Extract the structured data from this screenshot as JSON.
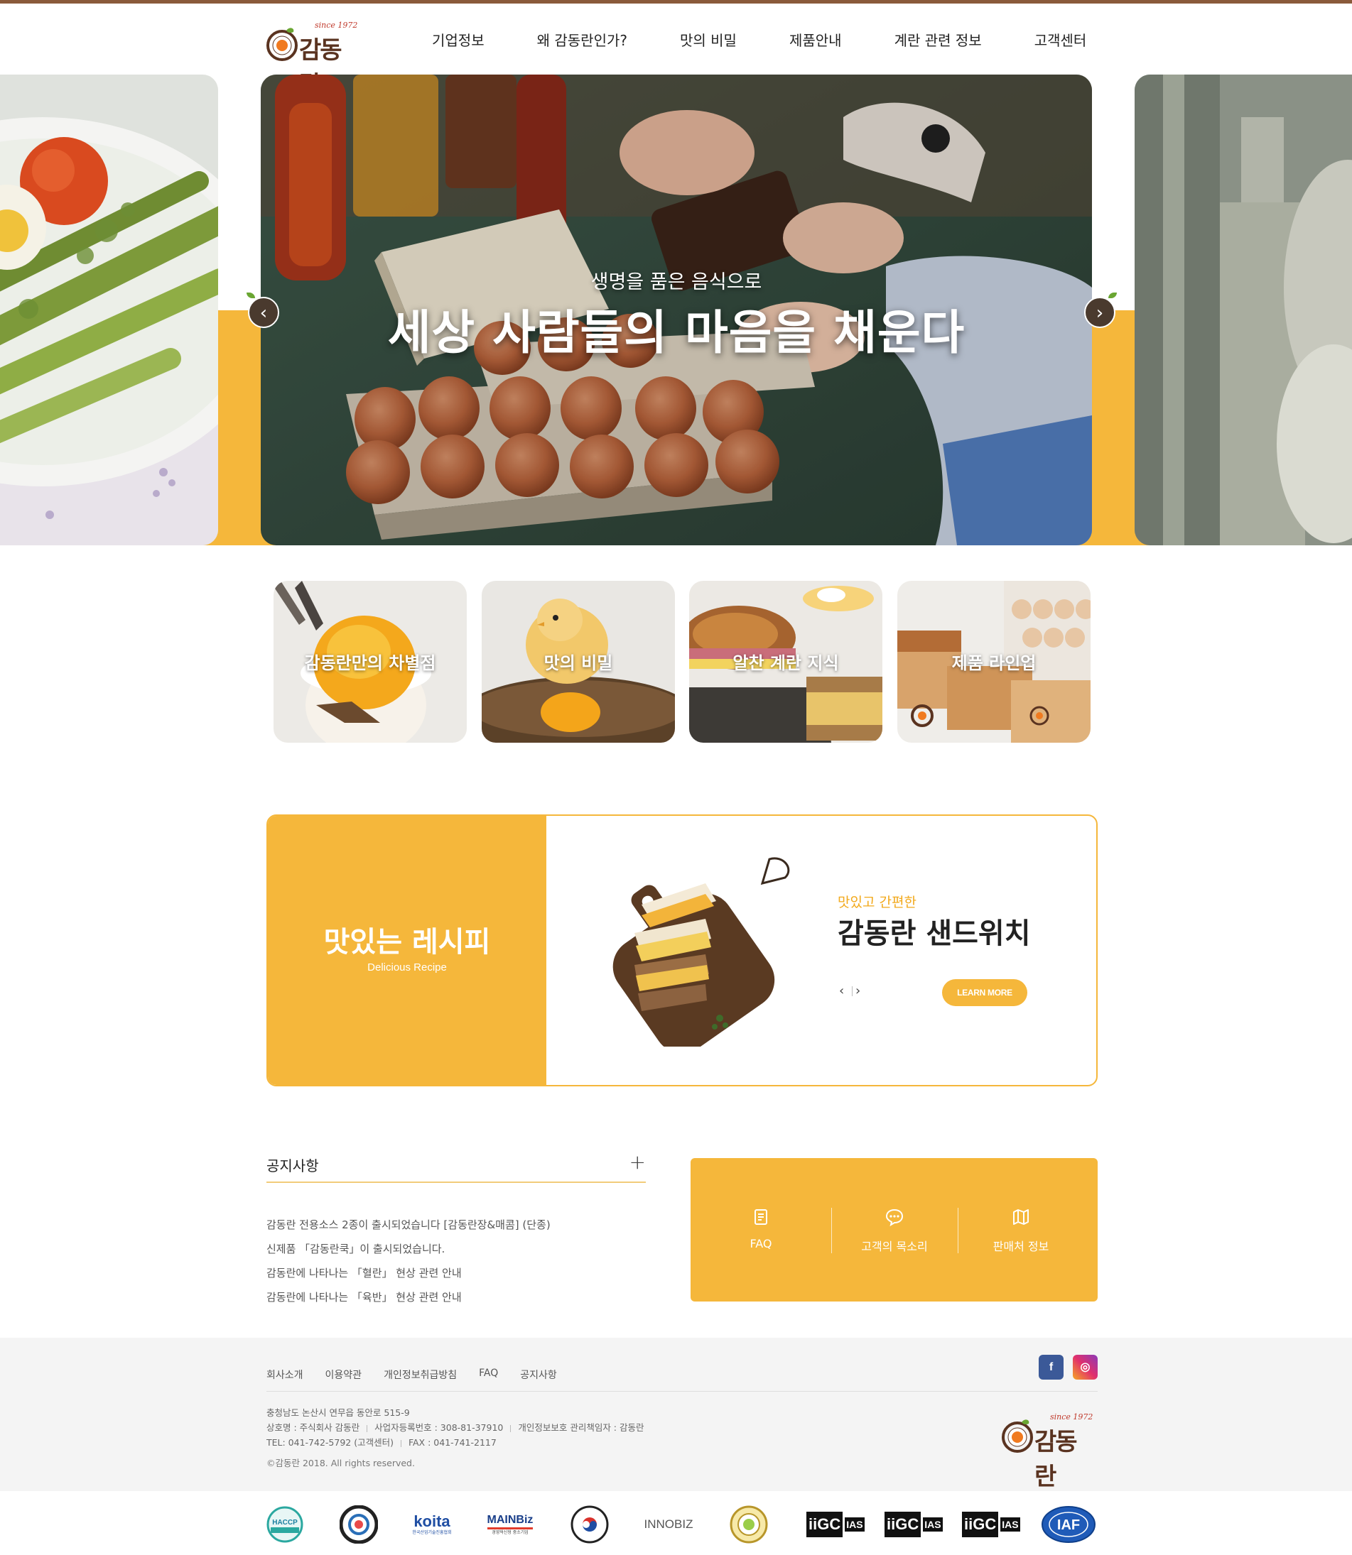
{
  "brand": {
    "since": "since 1972",
    "name": "감동란"
  },
  "nav": {
    "items": [
      "기업정보",
      "왜 감동란인가?",
      "맛의 비밀",
      "제품안내",
      "계란 관련 정보",
      "고객센터"
    ]
  },
  "hero": {
    "subtitle": "생명을 품은 음식으로",
    "title": "세상 사람들의 마음을 채운다",
    "prev_label": "‹",
    "next_label": "›"
  },
  "tiles": [
    "감동란만의 차별점",
    "맛의 비밀",
    "알찬 계란 지식",
    "제품 라인업"
  ],
  "recipe": {
    "title": "맛있는 레시피",
    "subtitle": "Delicious Recipe",
    "kicker": "맛있고 간편한",
    "name": "감동란 샌드위치",
    "prev": "‹",
    "next": "›",
    "button": "LEARN MORE"
  },
  "notice": {
    "title": "공지사항",
    "more": "+",
    "items": [
      "감동란 전용소스 2종이 출시되었습니다 [감동란장&매콤] (단종)",
      "신제품 「감동란쿡」이 출시되었습니다.",
      "감동란에 나타나는 「혈란」 현상 관련 안내",
      "감동란에 나타나는 「육반」 현상 관련 안내"
    ]
  },
  "quick": {
    "items": [
      {
        "label": "FAQ",
        "icon": "document-icon"
      },
      {
        "label": "고객의 목소리",
        "icon": "chat-bubble-icon"
      },
      {
        "label": "판매처 정보",
        "icon": "map-icon"
      }
    ]
  },
  "footer": {
    "links": [
      "회사소개",
      "이용약관",
      "개인정보취급방침",
      "FAQ",
      "공지사항"
    ],
    "address": "충청남도 논산시 연무읍 동안로 515-9",
    "company": "상호명 : 주식회사 감동란",
    "biz_no": "사업자등록번호 : 308-81-37910",
    "privacy": "개인정보보호 관리책임자 : 감동란",
    "tel": "TEL: 041-742-5792 (고객센터)",
    "fax": "FAX : 041-741-2117",
    "copyright": "©감동란 2018. All rights reserved.",
    "sns": {
      "facebook": "f",
      "instagram": "◎"
    }
  },
  "certs": {
    "haccp": "HACCP",
    "koita": "koita",
    "koita_sub": "한국산업기술진흥협회",
    "mainbiz": "MAINBiz",
    "mainbiz_sub": "경영혁신형 중소기업",
    "innobiz": "INNOBIZ",
    "igc": "iiGC",
    "ias": "IAS",
    "iaf": "IAF"
  },
  "colors": {
    "accent": "#f5b73b",
    "brown": "#5a3320",
    "top_line": "#8a5a3b"
  }
}
